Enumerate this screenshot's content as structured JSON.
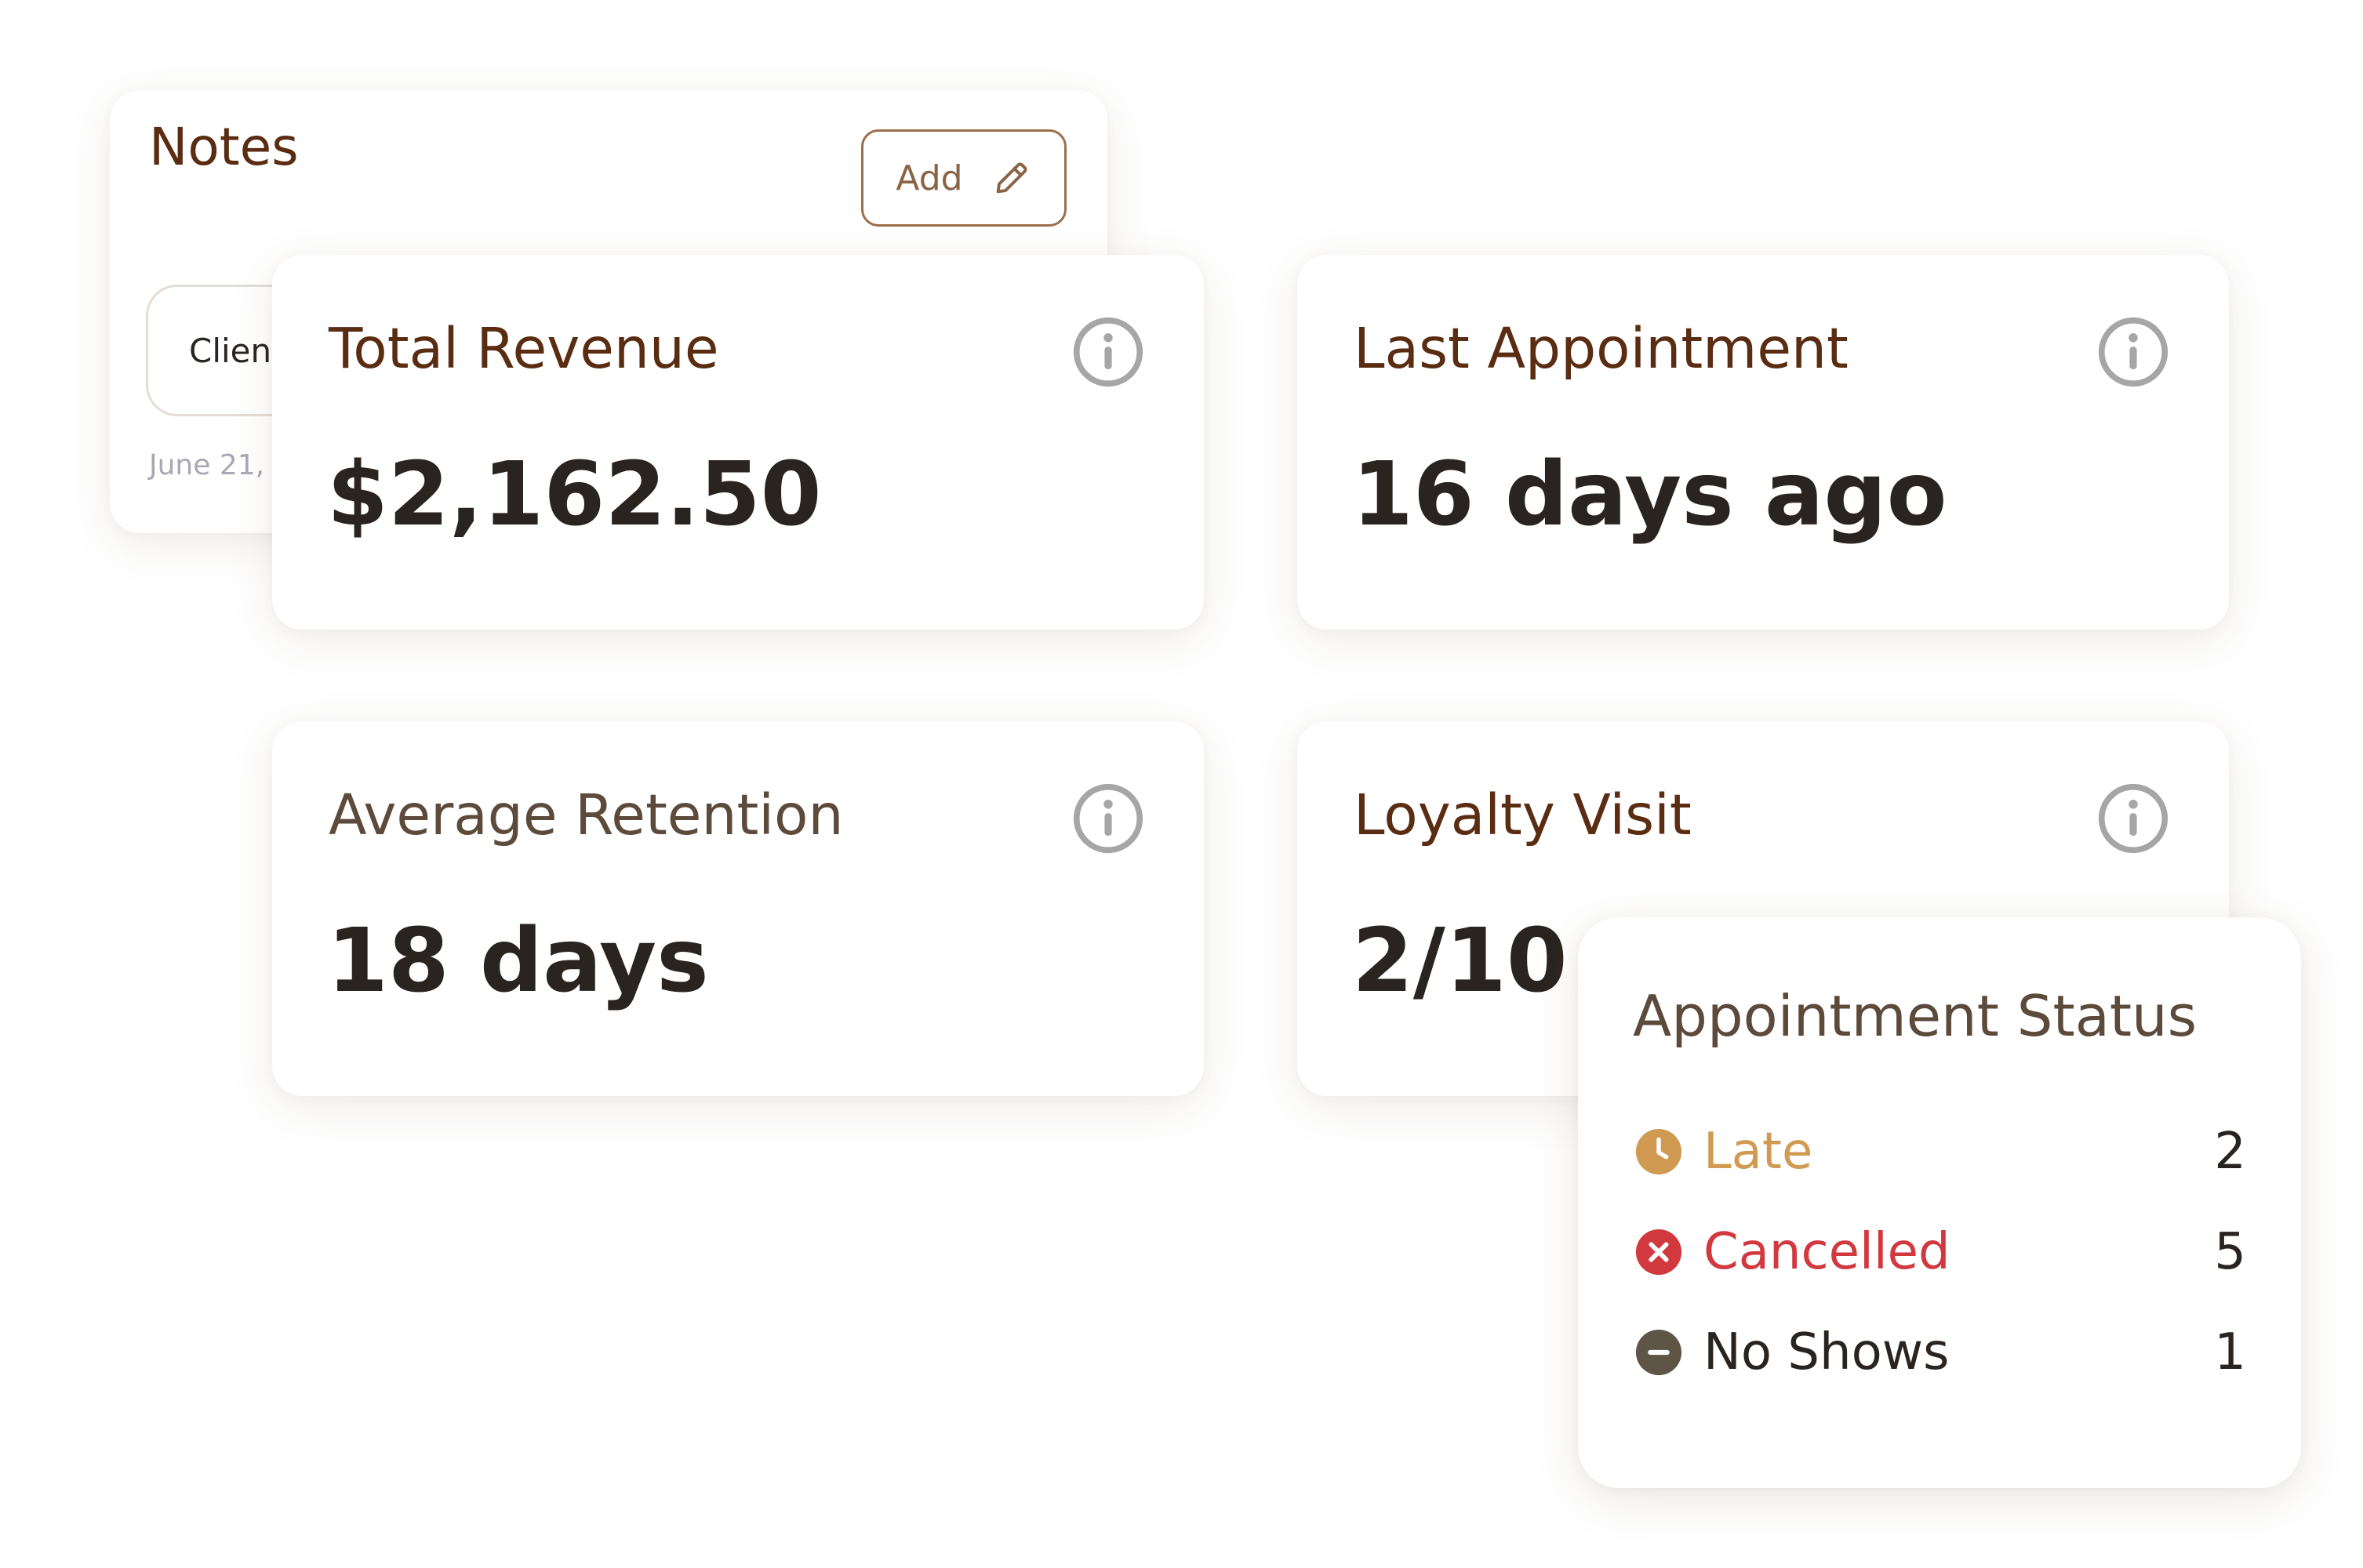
{
  "notes": {
    "title": "Notes",
    "add_label": "Add",
    "note_preview": "Clien",
    "note_date": "June 21,"
  },
  "metrics": {
    "total_revenue": {
      "label": "Total Revenue",
      "value": "$2,162.50"
    },
    "last_appointment": {
      "label": "Last Appointment",
      "value": "16 days ago"
    },
    "average_retention": {
      "label": "Average Retention",
      "value": "18 days"
    },
    "loyalty_visit": {
      "label": "Loyalty Visit",
      "value": "2/10"
    }
  },
  "appointment_status": {
    "title": "Appointment Status",
    "items": [
      {
        "label": "Late",
        "count": "2",
        "icon": "clock-icon",
        "color": "#d19a52"
      },
      {
        "label": "Cancelled",
        "count": "5",
        "icon": "x-circle-icon",
        "color": "#d1393f"
      },
      {
        "label": "No Shows",
        "count": "1",
        "icon": "minus-circle-icon",
        "color": "#5e5547"
      }
    ]
  },
  "colors": {
    "brown_accent": "#5a2c12",
    "value_text": "#2a2420",
    "icon_gray": "#a6a6a6",
    "border_brown": "#9b6f4c"
  }
}
